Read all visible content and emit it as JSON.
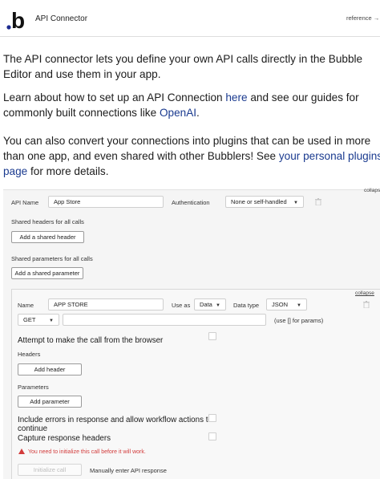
{
  "header": {
    "logo_letter": "b",
    "title": "API Connector",
    "reference_link": "reference →"
  },
  "intro": {
    "p1": "The API connector lets you define your own API calls directly in the Bubble Editor and use them in your app.",
    "p2_pre": "Learn about how to set up an API Connection ",
    "p2_link1": "here",
    "p2_mid": " and see our guides for commonly built connections like ",
    "p2_link2": "OpenAI",
    "p2_post": ".",
    "p3_pre": "You can also convert your connections into plugins that can be used in more than one app, and even shared with other Bubblers! See ",
    "p3_link": "your personal plugins page",
    "p3_post": " for more details."
  },
  "api": {
    "collapse_label": "collapse",
    "name_label": "API Name",
    "name_value": "App Store",
    "auth_label": "Authentication",
    "auth_value": "None or self-handled",
    "shared_headers_label": "Shared headers for all calls",
    "add_shared_header": "Add a shared header",
    "shared_params_label": "Shared parameters for all calls",
    "add_shared_param": "Add a shared parameter"
  },
  "call": {
    "collapse_label": "collapse",
    "name_label": "Name",
    "name_value": "APP STORE",
    "use_as_label": "Use as",
    "use_as_value": "Data",
    "data_type_label": "Data type",
    "data_type_value": "JSON",
    "method_value": "GET",
    "url_value": "",
    "url_hint": "(use [] for params)",
    "browser_call_label": "Attempt to make the call from the browser",
    "headers_label": "Headers",
    "add_header": "Add header",
    "params_label": "Parameters",
    "add_param": "Add parameter",
    "include_errors_label": "Include errors in response and allow workflow actions to continue",
    "capture_headers_label": "Capture response headers",
    "warning": "You need to initialize this call before it will work.",
    "initialize_button": "Initialize call",
    "manual_label": "Manually enter API response"
  },
  "colors": {
    "link": "#1a3a8f",
    "warning": "#d23b3b",
    "logo_dot": "#1c2b8f"
  },
  "icons": [
    "bubble-logo-icon",
    "trash-icon",
    "chevron-down-icon",
    "warning-icon"
  ]
}
